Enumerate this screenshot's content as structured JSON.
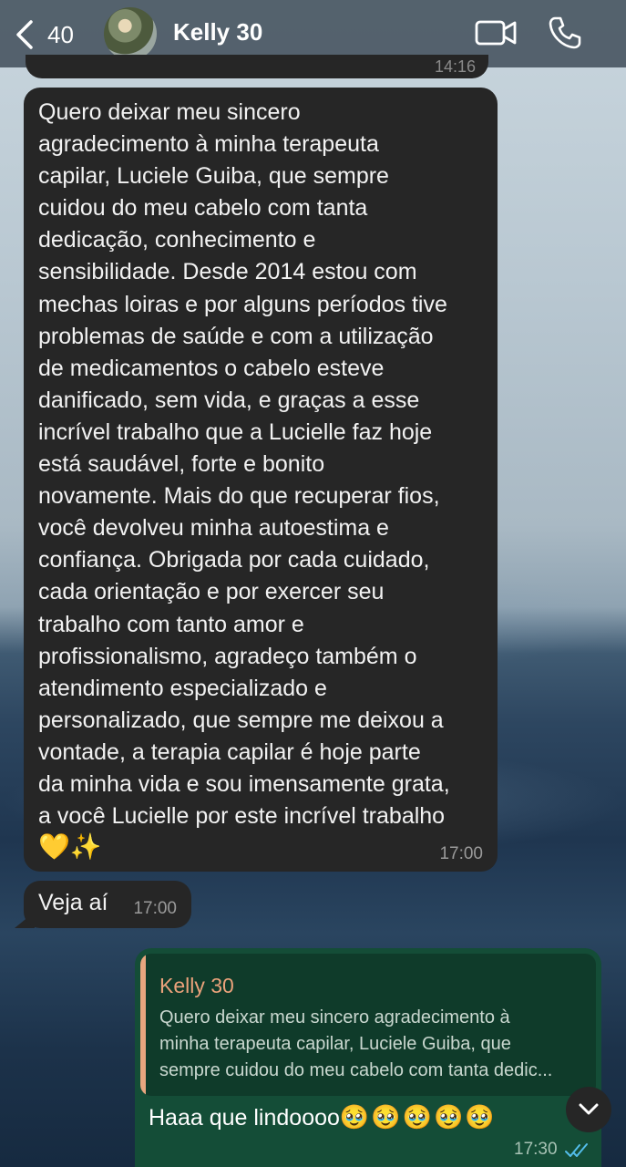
{
  "header": {
    "back_count": "40",
    "contact_name": "Kelly 30",
    "icons": [
      "chevron-left-icon",
      "video-camera-icon",
      "phone-icon"
    ]
  },
  "messages": {
    "previous_time": "14:16",
    "msg1": {
      "text": "Quero deixar meu sincero\nagradecimento à minha terapeuta\ncapilar, Luciele Guiba, que sempre\ncuidou do meu cabelo com tanta\ndedicação, conhecimento e\nsensibilidade. Desde 2014  estou com\nmechas loiras e por alguns períodos tive\nproblemas de saúde e com a utilização\nde medicamentos o cabelo esteve\ndanificado, sem vida, e graças a esse\nincrível trabalho que a Lucielle faz hoje\nestá saudável, forte e bonito\nnovamente. Mais do que recuperar fios,\nvocê devolveu minha autoestima e\nconfiança. Obrigada por cada cuidado,\ncada orientação e por exercer seu\ntrabalho com tanto amor e\nprofissionalismo, agradeço também o\natendimento especializado e\npersonalizado, que sempre me deixou a\nvontade, a terapia capilar é hoje parte\nda minha vida e sou imensamente grata,\na você Lucielle por este incrível trabalho",
      "emoji_heart": "💛",
      "emoji_sparkles": "✨",
      "time": "17:00"
    },
    "msg2": {
      "text": "Veja aí",
      "time": "17:00"
    },
    "outgoing": {
      "quote_author": "Kelly 30",
      "quote_text": "Quero deixar meu sincero agradecimento à\nminha terapeuta capilar, Luciele Guiba, que\nsempre cuidou do meu cabelo com tanta dedic...",
      "text": "Haaa que lindoooo",
      "emojis": "🥹🥹🥹🥹🥹",
      "time": "17:30",
      "status": "read-double-check-icon"
    }
  },
  "colors": {
    "incoming_bubble": "#262626",
    "outgoing_bubble": "#144d37",
    "quote_accent": "#eba27b",
    "read_ticks": "#53bdeb"
  }
}
